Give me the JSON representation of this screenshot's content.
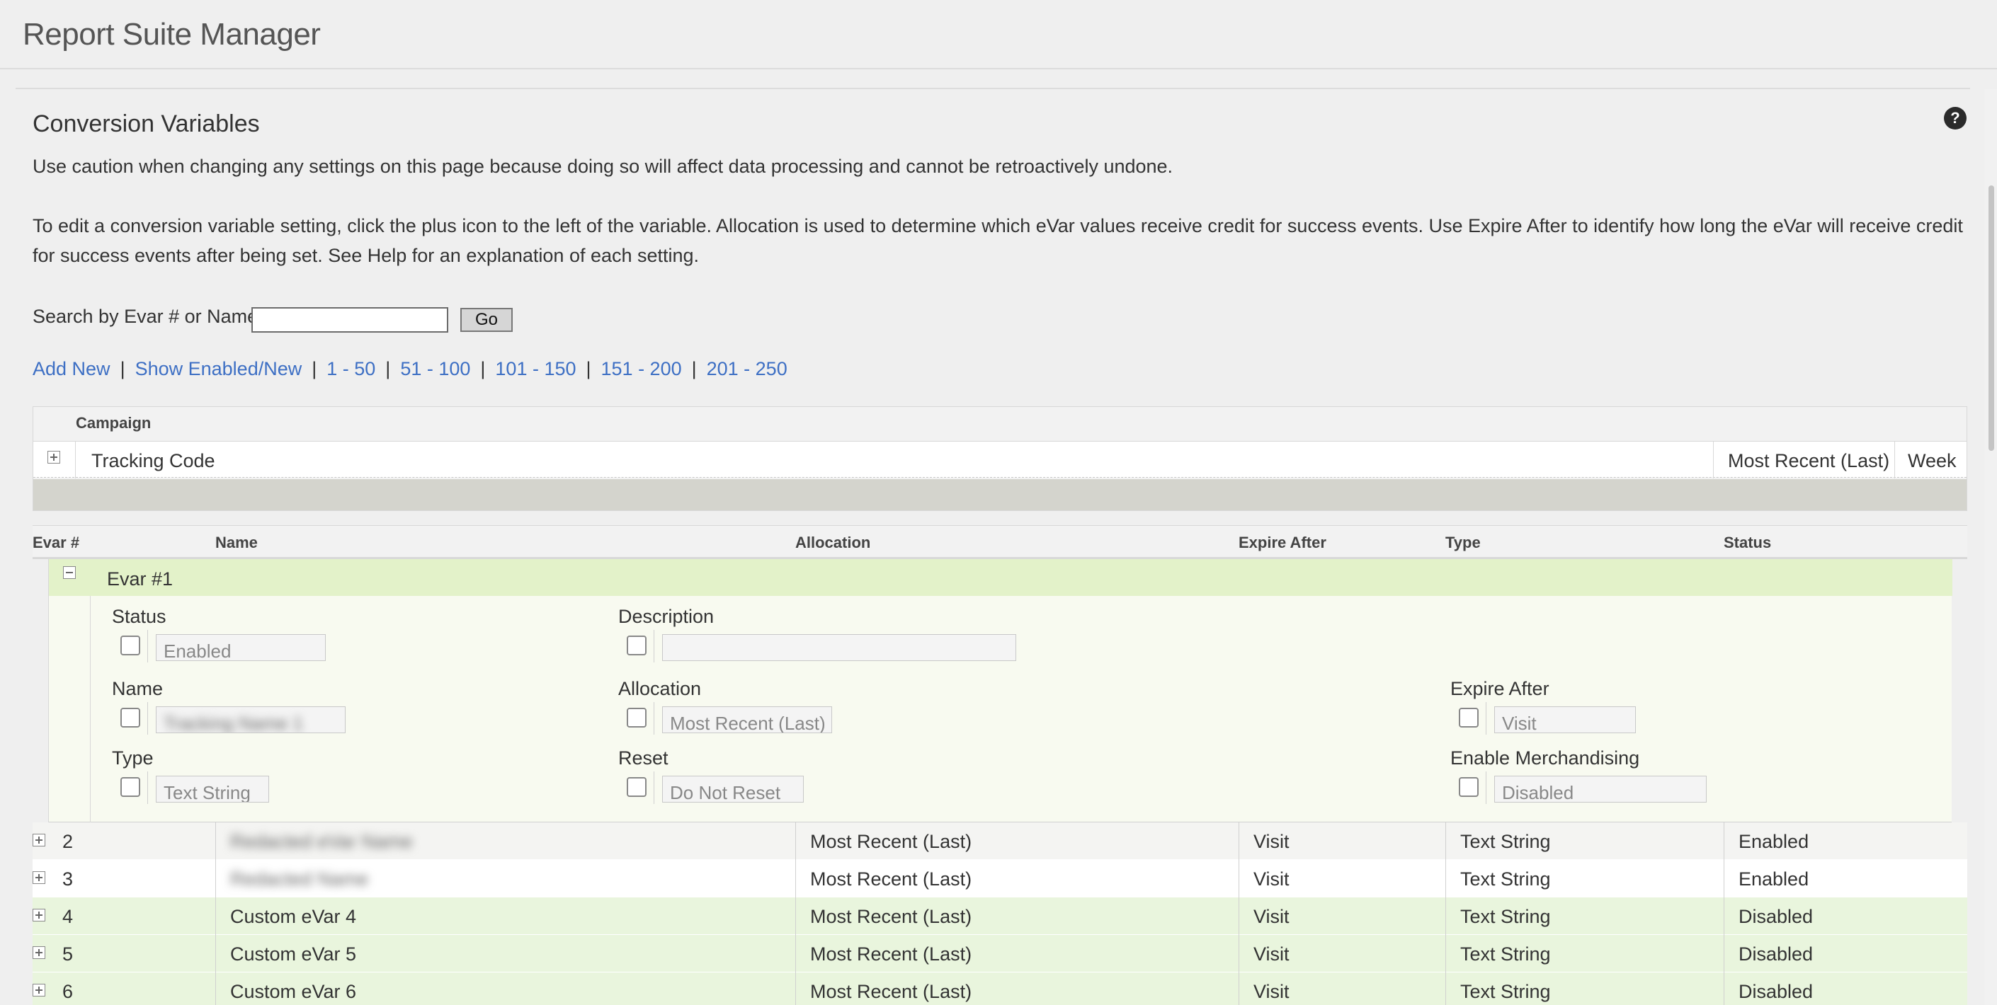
{
  "app": {
    "title": "Report Suite Manager"
  },
  "section": {
    "title": "Conversion Variables",
    "warning": "Use caution when changing any settings on this page because doing so will affect data processing and cannot be retroactively undone.",
    "help_text": "To edit a conversion variable setting, click the plus icon to the left of the variable. Allocation is used to determine which eVar values receive credit for success events. Use Expire After to identify how long the eVar will receive credit for success events after being set. See Help for an explanation of each setting."
  },
  "search": {
    "label": "Search by Evar # or Name:",
    "value": "",
    "go_label": "Go"
  },
  "nav": {
    "add_new": "Add New",
    "show_enabled": "Show Enabled/New",
    "sep": "|",
    "ranges": [
      "1 - 50",
      "51 - 100",
      "101 - 150",
      "151 - 200",
      "201 - 250"
    ]
  },
  "campaign": {
    "header": "Campaign",
    "name": "Tracking Code",
    "allocation": "Most Recent (Last)",
    "expire": "Week"
  },
  "table": {
    "headers": {
      "evar": "Evar #",
      "name": "Name",
      "allocation": "Allocation",
      "expire": "Expire After",
      "type": "Type",
      "status": "Status"
    },
    "expanded": {
      "title": "Evar #1",
      "status_label": "Status",
      "status_value": "Enabled",
      "description_label": "Description",
      "description_value": "",
      "name_label": "Name",
      "name_value": "Tracking Name 1",
      "allocation_label": "Allocation",
      "allocation_value": "Most Recent (Last)",
      "expire_label": "Expire After",
      "expire_value": "Visit",
      "type_label": "Type",
      "type_value": "Text String",
      "reset_label": "Reset",
      "reset_value": "Do Not Reset",
      "merch_label": "Enable Merchandising",
      "merch_value": "Disabled"
    },
    "rows": [
      {
        "num": "2",
        "name": "Redacted eVar Name",
        "allocation": "Most Recent (Last)",
        "expire": "Visit",
        "type": "Text String",
        "status": "Enabled"
      },
      {
        "num": "3",
        "name": "Redacted Name",
        "allocation": "Most Recent (Last)",
        "expire": "Visit",
        "type": "Text String",
        "status": "Enabled"
      },
      {
        "num": "4",
        "name": "Custom eVar 4",
        "allocation": "Most Recent (Last)",
        "expire": "Visit",
        "type": "Text String",
        "status": "Disabled"
      },
      {
        "num": "5",
        "name": "Custom eVar 5",
        "allocation": "Most Recent (Last)",
        "expire": "Visit",
        "type": "Text String",
        "status": "Disabled"
      },
      {
        "num": "6",
        "name": "Custom eVar 6",
        "allocation": "Most Recent (Last)",
        "expire": "Visit",
        "type": "Text String",
        "status": "Disabled"
      }
    ]
  },
  "colors": {
    "link": "#3d6fc4",
    "expanded_header": "#e3f2c9",
    "disabled_row": "#e9f5dd",
    "help_icon": "#2b2b2b"
  },
  "icons": {
    "help": "help-icon",
    "expand": "plus-icon",
    "collapse": "minus-icon"
  }
}
